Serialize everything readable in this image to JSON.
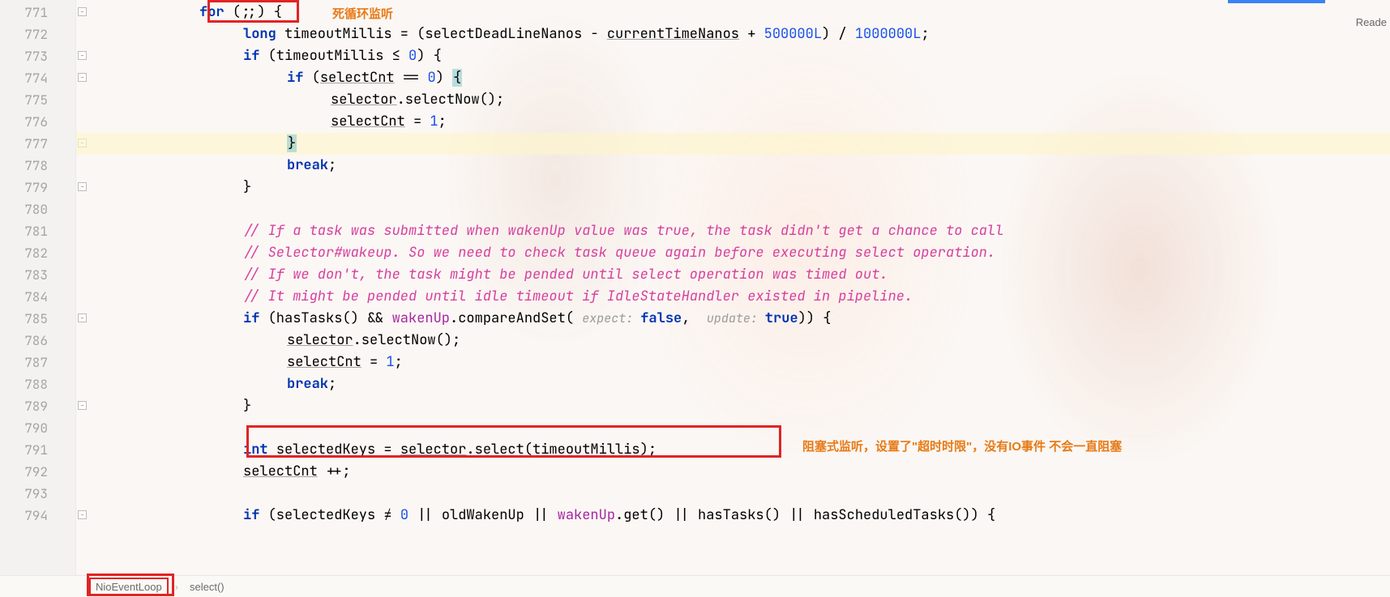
{
  "lines": {
    "start": 771,
    "end": 794
  },
  "reader_label": "Reade",
  "breadcrumb": {
    "class": "NioEventLoop",
    "method": "select()"
  },
  "annotations": {
    "loop": "死循环监听",
    "block": "阻塞式监听，设置了\"超时时限\"，没有IO事件 不会一直阻塞"
  },
  "code": {
    "l771_for": "for",
    "l771_rest": " (;;) {",
    "l772_long": "long",
    "l772_var": " timeoutMillis = (selectDeadLineNanos - ",
    "l772_ctn": "currentTimeNanos",
    "l772_plus": " + ",
    "l772_n1": "500000L",
    "l772_div": ") / ",
    "l772_n2": "1000000L",
    "l772_semi": ";",
    "l773_if": "if",
    "l773_cond": " (timeoutMillis ≤ ",
    "l773_zero": "0",
    "l773_rest": ") {",
    "l774_if": "if",
    "l774_open": " (",
    "l774_sc": "selectCnt",
    "l774_eq": " == ",
    "l774_zero": "0",
    "l774_close": ") ",
    "l774_brace": "{",
    "l775_sel": "selector",
    "l775_call": ".selectNow();",
    "l776_sc": "selectCnt",
    "l776_assign": " = ",
    "l776_one": "1",
    "l776_semi": ";",
    "l777_brace": "}",
    "l778_break": "break",
    "l778_semi": ";",
    "l779_brace": "}",
    "l781_c": "// If a task was submitted when wakenUp value was true, the task didn't get a chance to call",
    "l782_c": "// Selector#wakeup. So we need to check task queue again before executing select operation.",
    "l783_c": "// If we don't, the task might be pended until select operation was timed out.",
    "l784_c": "// It might be pended until idle timeout if IdleStateHandler existed in pipeline.",
    "l785_if": "if",
    "l785_a": " (hasTasks() && ",
    "l785_wu": "wakenUp",
    "l785_b": ".compareAndSet( ",
    "l785_h1": "expect: ",
    "l785_false": "false",
    "l785_comma": ",  ",
    "l785_h2": "update: ",
    "l785_true": "true",
    "l785_end": ")) {",
    "l786_sel": "selector",
    "l786_call": ".selectNow();",
    "l787_sc": "selectCnt",
    "l787_assign": " = ",
    "l787_one": "1",
    "l787_semi": ";",
    "l788_break": "break",
    "l788_semi": ";",
    "l789_brace": "}",
    "l791_int": "int",
    "l791_a": " selectedKeys = ",
    "l791_sel": "selector",
    "l791_b": ".select(timeoutMillis);",
    "l792_sc": "selectCnt",
    "l792_inc": " ++;",
    "l794_if": "if",
    "l794_a": " (selectedKeys ≠ ",
    "l794_zero": "0",
    "l794_b": " || oldWakenUp || ",
    "l794_wu": "wakenUp",
    "l794_c": ".get() || hasTasks() || hasScheduledTasks()) {"
  }
}
